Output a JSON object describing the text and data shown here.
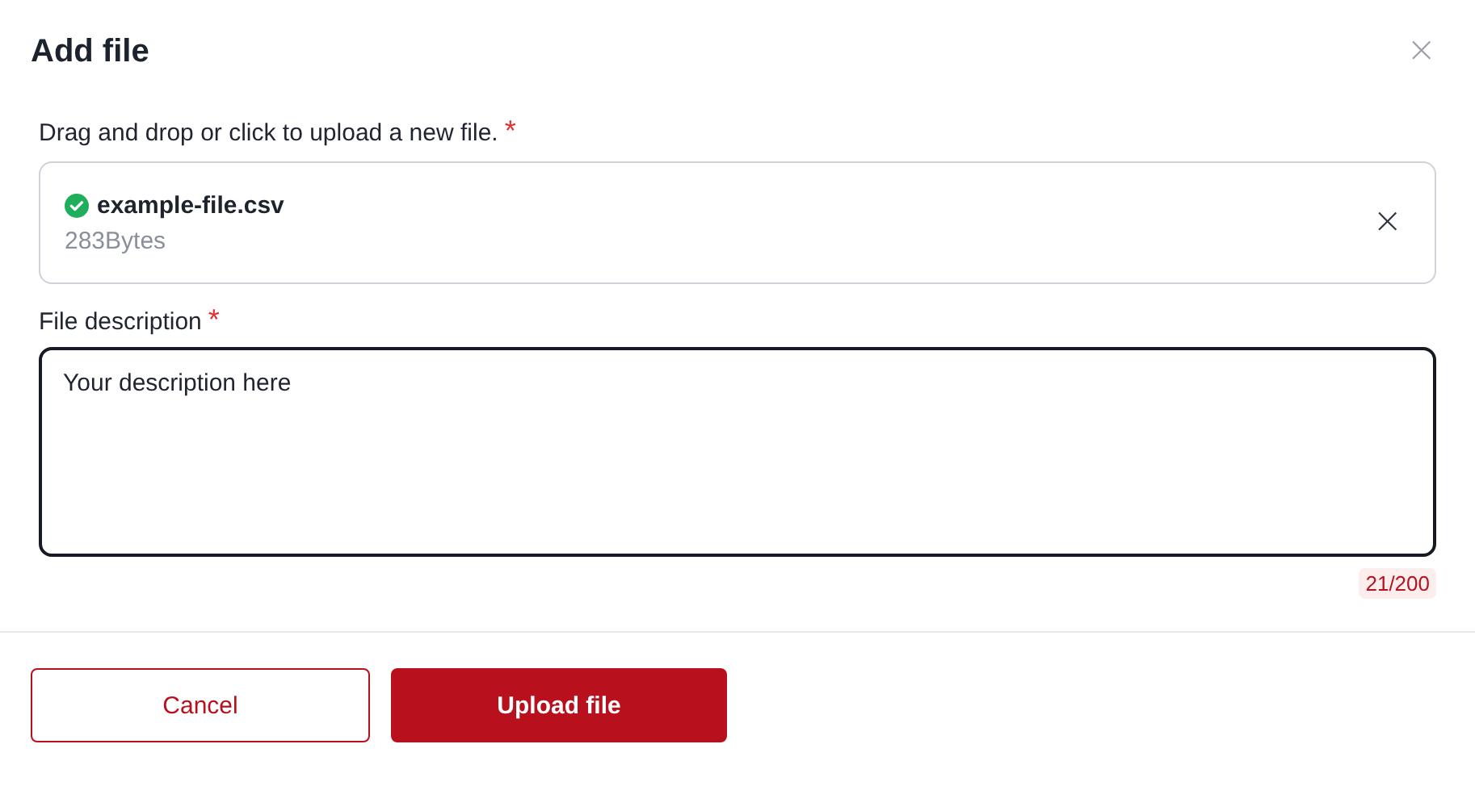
{
  "dialog": {
    "title": "Add file",
    "close_label": "×"
  },
  "upload": {
    "label": "Drag and drop or click to upload a new file.",
    "required_mark": "*",
    "file": {
      "name": "example-file.csv",
      "size": "283Bytes",
      "uploaded": true,
      "remove_label": "×"
    }
  },
  "description": {
    "label": "File description",
    "required_mark": "*",
    "value": "Your description here",
    "focused": true,
    "counter": "21/200"
  },
  "buttons": [
    {
      "label": "Cancel",
      "kind": "secondary"
    },
    {
      "label": "Upload file",
      "kind": "primary"
    }
  ]
}
